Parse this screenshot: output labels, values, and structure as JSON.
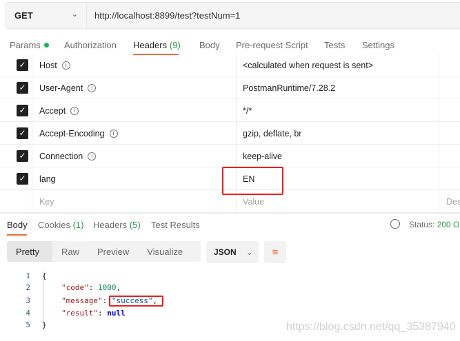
{
  "request": {
    "method": "GET",
    "url": "http://localhost:8899/test?testNum=1"
  },
  "req_tabs": [
    {
      "label": "Params"
    },
    {
      "label": "Authorization"
    },
    {
      "label": "Headers",
      "count": "(9)"
    },
    {
      "label": "Body"
    },
    {
      "label": "Pre-request Script"
    },
    {
      "label": "Tests"
    },
    {
      "label": "Settings"
    }
  ],
  "headers": [
    {
      "key": "Host",
      "value": "<calculated when request is sent>",
      "info": true
    },
    {
      "key": "User-Agent",
      "value": "PostmanRuntime/7.28.2",
      "info": true
    },
    {
      "key": "Accept",
      "value": "*/*",
      "info": true
    },
    {
      "key": "Accept-Encoding",
      "value": "gzip, deflate, br",
      "info": true
    },
    {
      "key": "Connection",
      "value": "keep-alive",
      "info": true
    },
    {
      "key": "lang",
      "value": "EN",
      "info": false
    }
  ],
  "placeholders": {
    "key": "Key",
    "value": "Value",
    "desc": "Des"
  },
  "resp_tabs": [
    {
      "label": "Body"
    },
    {
      "label": "Cookies",
      "count": "(1)"
    },
    {
      "label": "Headers",
      "count": "(5)"
    },
    {
      "label": "Test Results"
    }
  ],
  "status": {
    "label": "Status:",
    "value": "200 O"
  },
  "view_modes": [
    "Pretty",
    "Raw",
    "Preview",
    "Visualize"
  ],
  "format": "JSON",
  "code": {
    "open": "{",
    "code_key": "\"code\"",
    "code_val": "1000",
    "msg_key": "\"message\"",
    "msg_val": "\"success\"",
    "res_key": "\"result\"",
    "res_val": "null",
    "close": "}",
    "line_numbers": [
      "1",
      "2",
      "3",
      "4",
      "5"
    ]
  },
  "watermark": "https://blog.csdn.net/qq_35387940"
}
